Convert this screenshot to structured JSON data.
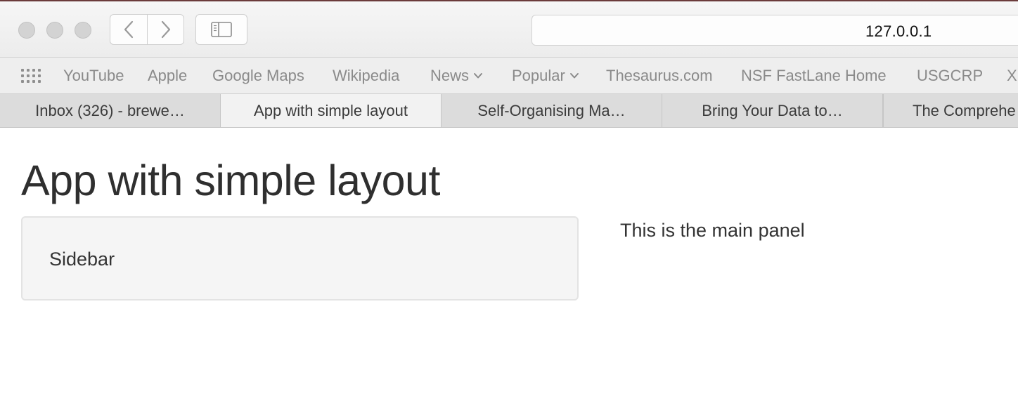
{
  "browser": {
    "address": "127.0.0.1"
  },
  "favorites": [
    {
      "label": "YouTube",
      "dropdown": false
    },
    {
      "label": "Apple",
      "dropdown": false
    },
    {
      "label": "Google Maps",
      "dropdown": false
    },
    {
      "label": "Wikipedia",
      "dropdown": false
    },
    {
      "label": "News",
      "dropdown": true
    },
    {
      "label": "Popular",
      "dropdown": true
    },
    {
      "label": "Thesaurus.com",
      "dropdown": false
    },
    {
      "label": "NSF FastLane Home",
      "dropdown": false
    },
    {
      "label": "USGCRP",
      "dropdown": false
    },
    {
      "label": "X",
      "dropdown": false
    }
  ],
  "tabs": [
    {
      "label": "Inbox (326) - brewe…",
      "active": false
    },
    {
      "label": "App with simple layout",
      "active": true
    },
    {
      "label": "Self-Organising Ma…",
      "active": false
    },
    {
      "label": "Bring Your Data to…",
      "active": false
    },
    {
      "label": "The Comprehe",
      "active": false
    }
  ],
  "page": {
    "title": "App with simple layout",
    "sidebar_text": "Sidebar",
    "main_text": "This is the main panel"
  },
  "icons": {
    "apps": "grid-icon",
    "back": "chevron-left-icon",
    "forward": "chevron-right-icon",
    "sidebar": "sidebar-icon"
  }
}
